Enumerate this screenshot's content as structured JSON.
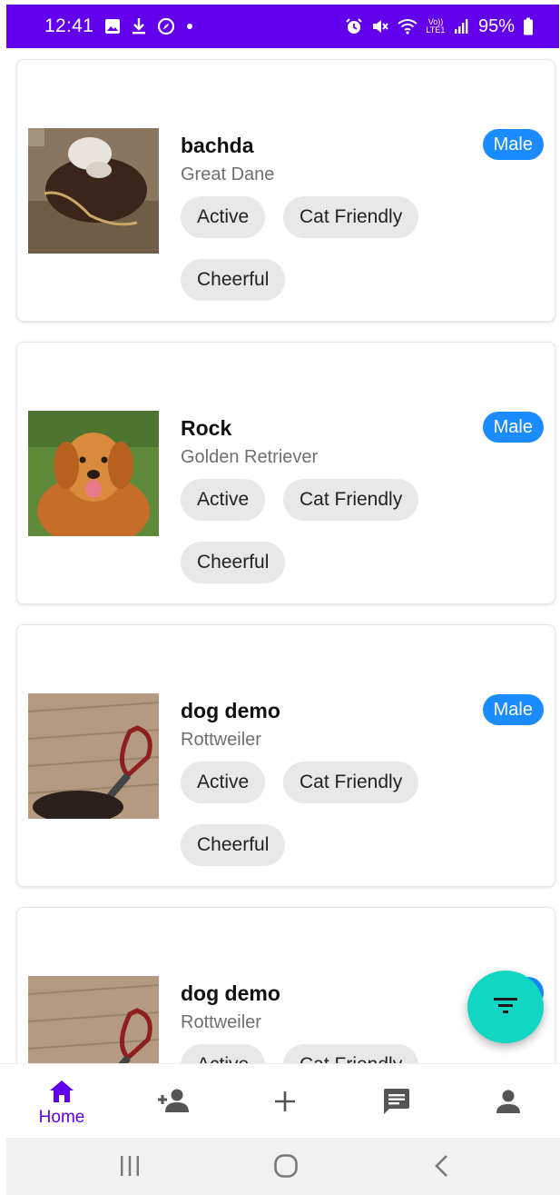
{
  "status_bar": {
    "time": "12:41",
    "battery": "95%",
    "network": "Vo)) LTE1",
    "icons": [
      "gallery-icon",
      "download-icon",
      "compass-icon",
      "dot-icon",
      "alarm-icon",
      "mute-icon",
      "wifi-icon",
      "signal-icon",
      "battery-icon"
    ]
  },
  "pets": [
    {
      "name": "bachda",
      "breed": "Great Dane",
      "gender": "Male",
      "tags": [
        "Active",
        "Cat Friendly",
        "Cheerful"
      ]
    },
    {
      "name": "Rock",
      "breed": "Golden Retriever",
      "gender": "Male",
      "tags": [
        "Active",
        "Cat Friendly",
        "Cheerful"
      ]
    },
    {
      "name": "dog demo",
      "breed": "Rottweiler",
      "gender": "Male",
      "tags": [
        "Active",
        "Cat Friendly",
        "Cheerful"
      ]
    },
    {
      "name": "dog demo",
      "breed": "Rottweiler",
      "gender": "Male",
      "tags": [
        "Active",
        "Cat Friendly"
      ]
    }
  ],
  "fab": {
    "icon": "filter-icon"
  },
  "bottom_nav": {
    "items": [
      {
        "label": "Home",
        "icon": "home-icon",
        "active": true
      },
      {
        "icon": "add-friend-icon"
      },
      {
        "icon": "plus-icon"
      },
      {
        "icon": "chat-icon"
      },
      {
        "icon": "profile-icon"
      }
    ]
  },
  "system_nav": {
    "icons": [
      "recent-apps-icon",
      "home-circle-icon",
      "back-icon"
    ]
  },
  "colors": {
    "primary": "#6200ee",
    "badge": "#1a8cff",
    "fab": "#12d6c4",
    "tag_bg": "#e8e8e8"
  }
}
